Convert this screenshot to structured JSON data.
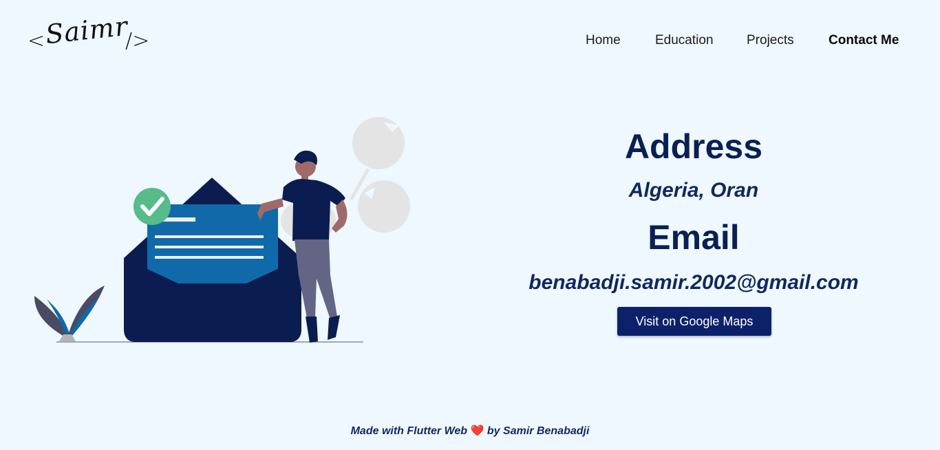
{
  "logo": {
    "bracket_left": "<",
    "signature": "Saimr",
    "bracket_right": "/>"
  },
  "nav": {
    "items": [
      {
        "label": "Home"
      },
      {
        "label": "Education"
      },
      {
        "label": "Projects"
      },
      {
        "label": "Contact Me",
        "active": true
      }
    ]
  },
  "illustration": {
    "icon": "mail-confirmation-illustration",
    "colors": {
      "envelope": "#0b1c50",
      "letter": "#106aaa",
      "check": "#57bb8a",
      "person_pants": "#646484"
    }
  },
  "contact": {
    "address_title": "Address",
    "address_value": "Algeria, Oran",
    "email_title": "Email",
    "email_value": "benabadji.samir.2002@gmail.com",
    "maps_button": "Visit on Google Maps"
  },
  "footer": {
    "prefix": "Made with Flutter Web",
    "heart": "❤️",
    "suffix": "by Samir Benabadji"
  },
  "colors": {
    "background": "#eef8fe",
    "primary": "#0d216b",
    "heading": "#0b1f55"
  }
}
